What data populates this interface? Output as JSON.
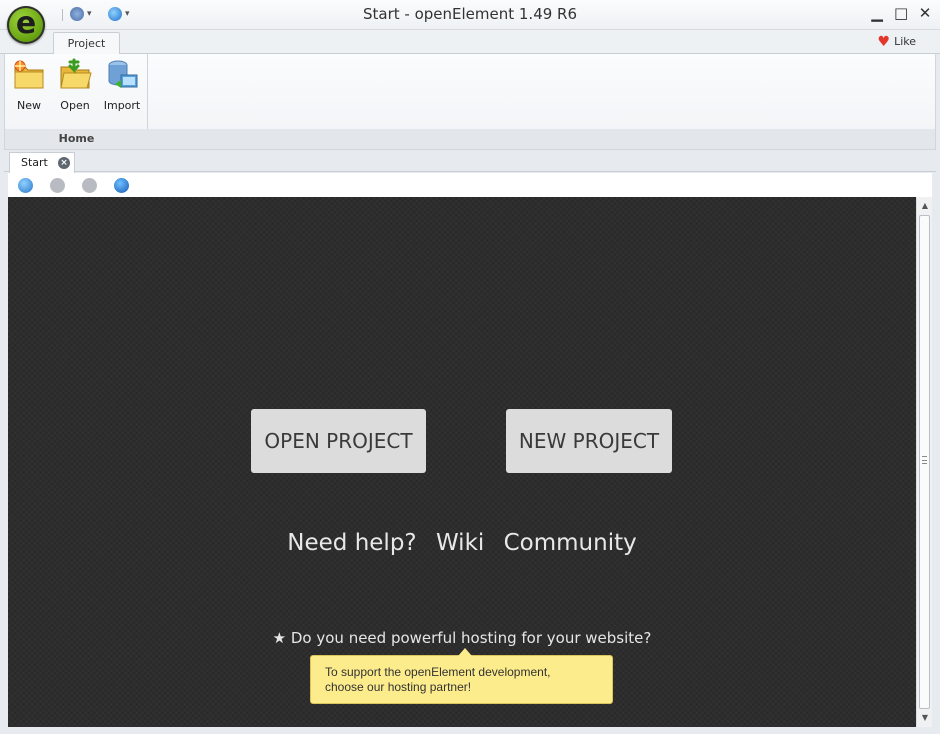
{
  "window": {
    "title": "Start - openElement 1.49 R6",
    "minimize": "▁",
    "maximize": "□",
    "close": "✕"
  },
  "app_logo_letter": "e",
  "ribbon": {
    "tabs": [
      {
        "label": "Project"
      }
    ],
    "like_label": "Like",
    "group_label": "Home",
    "buttons": [
      {
        "label": "New",
        "icon": "new-folder-icon"
      },
      {
        "label": "Open",
        "icon": "open-folder-icon"
      },
      {
        "label": "Import",
        "icon": "import-database-icon"
      }
    ]
  },
  "document_tabs": [
    {
      "label": "Start"
    }
  ],
  "navigation": [
    "home-icon",
    "back-icon",
    "forward-icon",
    "refresh-icon"
  ],
  "start_page": {
    "open_project": "OPEN PROJECT",
    "new_project": "NEW PROJECT",
    "help_prefix": "Need help?",
    "wiki_link": "Wiki",
    "community_link": "Community",
    "hosting_text": "★ Do you need powerful hosting for your website?",
    "tooltip_line1": "To support the openElement development,",
    "tooltip_line2": "choose our hosting partner!"
  },
  "colors": {
    "content_bg": "#2b2b2b",
    "button_bg": "#dcdcdc",
    "tooltip_bg": "#fcec8c",
    "logo_green": "#6aa514"
  }
}
